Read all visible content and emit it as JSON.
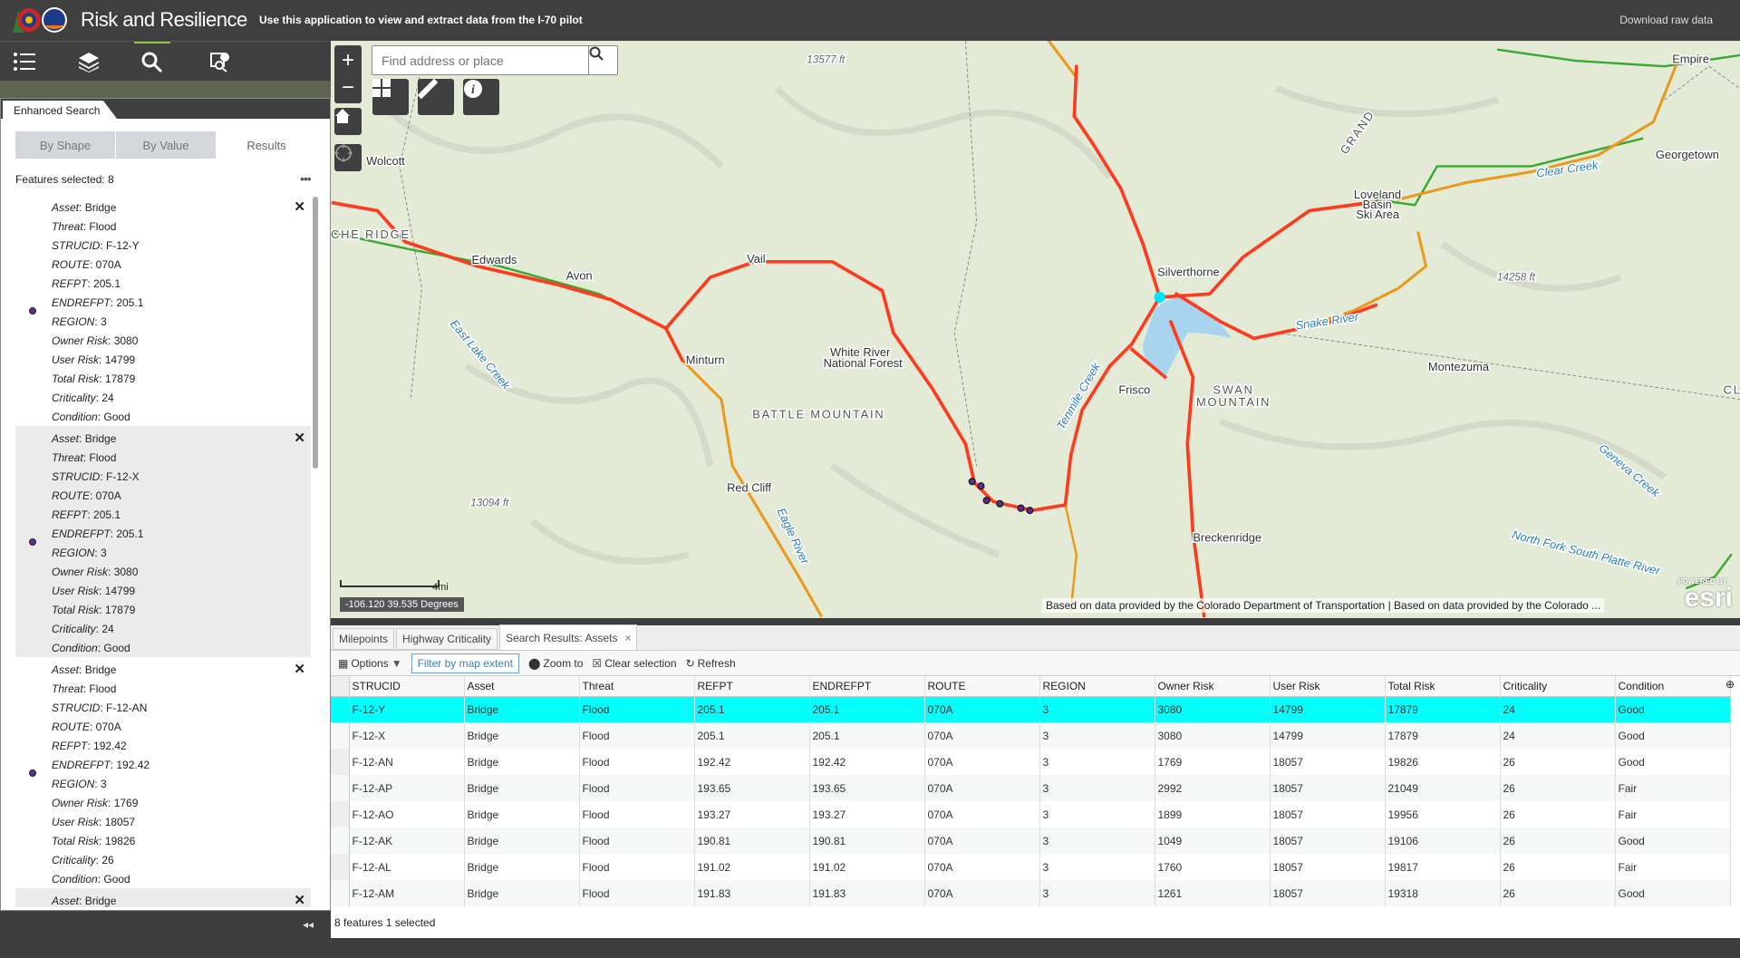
{
  "header": {
    "title": "Risk and Resilience",
    "subtitle": "Use this application to view and extract data from the I-70 pilot",
    "download_label": "Download raw data"
  },
  "toolbar": {
    "icons": [
      "list-icon",
      "layers-icon",
      "search-icon",
      "report-icon"
    ],
    "active": "search-icon"
  },
  "panel": {
    "tab_label": "Enhanced Search",
    "subtabs": [
      "By Shape",
      "By Value",
      "Results"
    ],
    "selected_subtab": "Results",
    "features_selected": "Features selected: 8",
    "more_label": "•••",
    "records": [
      {
        "Asset": "Bridge",
        "Threat": "Flood",
        "STRUCID": "F-12-Y",
        "ROUTE": "070A",
        "REFPT": "205.1",
        "ENDREFPT": "205.1",
        "REGION": "3",
        "Owner Risk": "3080",
        "User Risk": "14799",
        "Total Risk": "17879",
        "Criticality": "24",
        "Condition": "Good"
      },
      {
        "Asset": "Bridge",
        "Threat": "Flood",
        "STRUCID": "F-12-X",
        "ROUTE": "070A",
        "REFPT": "205.1",
        "ENDREFPT": "205.1",
        "REGION": "3",
        "Owner Risk": "3080",
        "User Risk": "14799",
        "Total Risk": "17879",
        "Criticality": "24",
        "Condition": "Good"
      },
      {
        "Asset": "Bridge",
        "Threat": "Flood",
        "STRUCID": "F-12-AN",
        "ROUTE": "070A",
        "REFPT": "192.42",
        "ENDREFPT": "192.42",
        "REGION": "3",
        "Owner Risk": "1769",
        "User Risk": "18057",
        "Total Risk": "19826",
        "Criticality": "26",
        "Condition": "Good"
      },
      {
        "Asset": "Bridge"
      }
    ],
    "point_color": "#5b2d8e"
  },
  "map": {
    "search_placeholder": "Find address or place",
    "scale_label": "4mi",
    "coordinates": "-106.120 39.535 Degrees",
    "attribution": "Based on data provided by the Colorado Department of Transportation | Based on data provided by the Colorado ...",
    "esri_label": "esri",
    "powered_by": "POWERED BY",
    "labels": {
      "wolcott": "Wolcott",
      "edwards": "Edwards",
      "avon": "Avon",
      "vail": "Vail",
      "minturn": "Minturn",
      "wrnf1": "White River",
      "wrnf2": "National Forest",
      "battle": "BATTLE MOUNTAIN",
      "redcliff": "Red Cliff",
      "eagleriver": "Eagle River",
      "silverthorne": "Silverthorne",
      "frisco": "Frisco",
      "swan1": "SWAN",
      "swan2": "MOUNTAIN",
      "breck": "Breckenridge",
      "montezuma": "Montezuma",
      "loveland1": "Loveland",
      "loveland2": "Basin",
      "loveland3": "Ski Area",
      "georgetown": "Georgetown",
      "empire": "Empire",
      "clearcreek": "Clear Creek",
      "snakeriver": "Snake River",
      "nfspr": "North Fork South Platte River",
      "geneva": "Geneva Creek",
      "tenmile": "Tenmile Creek",
      "lakecreek": "East Lake Creek",
      "grand": "GRAND",
      "ridge": "CHE RIDGE",
      "cl": "CL",
      "e1": "13577 ft",
      "e2": "13094 ft",
      "e3": "14258 ft"
    },
    "colors": {
      "high_risk_route": "#ff3b1f",
      "medium_route": "#e99a1c",
      "low_route": "#3aa832",
      "selected": "#00e5ff"
    }
  },
  "table": {
    "tabs": [
      "Milepoints",
      "Highway Criticality",
      "Search Results: Assets"
    ],
    "active_tab": "Search Results: Assets",
    "toolbar": {
      "options": "Options",
      "filter": "Filter by map extent",
      "zoom": "Zoom to",
      "clear": "Clear selection",
      "refresh": "Refresh"
    },
    "columns": [
      "STRUCID",
      "Asset",
      "Threat",
      "REFPT",
      "ENDREFPT",
      "ROUTE",
      "REGION",
      "Owner Risk",
      "User Risk",
      "Total Risk",
      "Criticality",
      "Condition"
    ],
    "rows": [
      [
        "F-12-Y",
        "Bridge",
        "Flood",
        "205.1",
        "205.1",
        "070A",
        "3",
        "3080",
        "14799",
        "17879",
        "24",
        "Good"
      ],
      [
        "F-12-X",
        "Bridge",
        "Flood",
        "205.1",
        "205.1",
        "070A",
        "3",
        "3080",
        "14799",
        "17879",
        "24",
        "Good"
      ],
      [
        "F-12-AN",
        "Bridge",
        "Flood",
        "192.42",
        "192.42",
        "070A",
        "3",
        "1769",
        "18057",
        "19826",
        "26",
        "Good"
      ],
      [
        "F-12-AP",
        "Bridge",
        "Flood",
        "193.65",
        "193.65",
        "070A",
        "3",
        "2992",
        "18057",
        "21049",
        "26",
        "Fair"
      ],
      [
        "F-12-AO",
        "Bridge",
        "Flood",
        "193.27",
        "193.27",
        "070A",
        "3",
        "1899",
        "18057",
        "19956",
        "26",
        "Fair"
      ],
      [
        "F-12-AK",
        "Bridge",
        "Flood",
        "190.81",
        "190.81",
        "070A",
        "3",
        "1049",
        "18057",
        "19106",
        "26",
        "Good"
      ],
      [
        "F-12-AL",
        "Bridge",
        "Flood",
        "191.02",
        "191.02",
        "070A",
        "3",
        "1760",
        "18057",
        "19817",
        "26",
        "Fair"
      ],
      [
        "F-12-AM",
        "Bridge",
        "Flood",
        "191.83",
        "191.83",
        "070A",
        "3",
        "1261",
        "18057",
        "19318",
        "26",
        "Good"
      ]
    ],
    "selected_row": 0,
    "selected_color": "#00ffff",
    "footer": "8 features   1 selected"
  }
}
